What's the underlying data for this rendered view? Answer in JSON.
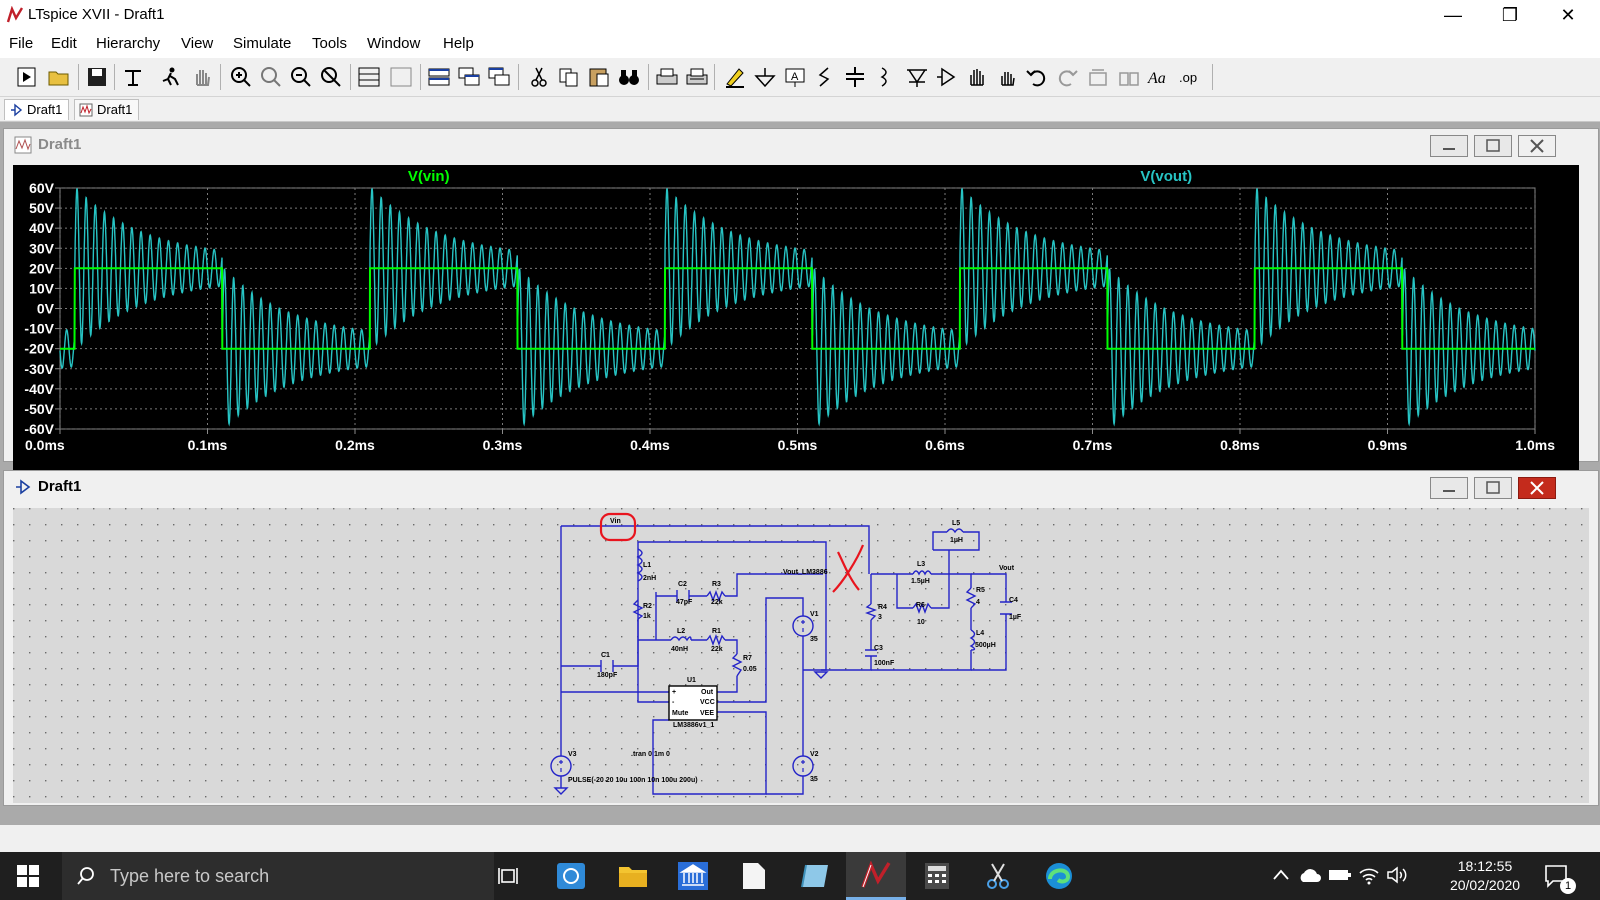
{
  "app": {
    "title": "LTspice XVII - Draft1"
  },
  "menu": [
    "File",
    "Edit",
    "Hierarchy",
    "View",
    "Simulate",
    "Tools",
    "Window",
    "Help"
  ],
  "tabs": [
    {
      "label": "Draft1",
      "icon": "schematic-icon",
      "active": true
    },
    {
      "label": "Draft1",
      "icon": "waveform-icon",
      "active": false
    }
  ],
  "waveform_window": {
    "title": "Draft1",
    "chart_data": {
      "type": "line",
      "series": [
        {
          "name": "V(vin)",
          "color": "#00ff00",
          "shape": "square",
          "amplitude": 20,
          "period_ms": 0.2
        },
        {
          "name": "V(vout)",
          "color": "#27c4c4",
          "shape": "damped-ringing",
          "offset": 20,
          "peak": 56,
          "ring_decay_to": 5
        }
      ],
      "x_ticks": [
        "0.0ms",
        "0.1ms",
        "0.2ms",
        "0.3ms",
        "0.4ms",
        "0.5ms",
        "0.6ms",
        "0.7ms",
        "0.8ms",
        "0.9ms",
        "1.0ms"
      ],
      "y_ticks": [
        "60V",
        "50V",
        "40V",
        "30V",
        "20V",
        "10V",
        "0V",
        "-10V",
        "-20V",
        "-30V",
        "-40V",
        "-50V",
        "-60V"
      ],
      "xlim": [
        0,
        1.0
      ],
      "ylim": [
        -60,
        60
      ],
      "grid": true,
      "background": "#000000"
    }
  },
  "schematic_window": {
    "title": "Draft1",
    "labels": {
      "vin": "Vin",
      "vout_lm": "Vout_LM3886",
      "vout": "Vout",
      "L1": "L1",
      "L1v": "2nH",
      "R2": "R2",
      "R2v": "1k",
      "C2": "C2",
      "C2v": "47pF",
      "R3": "R3",
      "R3v": "22k",
      "L2": "L2",
      "L2v": "40nH",
      "R1": "R1",
      "R1v": "22k",
      "R7": "R7",
      "R7v": "0.05",
      "C1": "C1",
      "C1v": "180pF",
      "U1": "U1",
      "U1name": "LM3886v1_1",
      "pin_plus": "+",
      "pin_minus": "-",
      "pin_mute": "Mute",
      "pin_out": "Out",
      "pin_vcc": "VCC",
      "pin_vee": "VEE",
      "V1": "V1",
      "V1v": "35",
      "V2": "V2",
      "V2v": "35",
      "V3": "V3",
      "V3v": "PULSE(-20 20 10u 100n 10n 100u 200u)",
      "tran": ".tran 0 1m 0",
      "R4": "R4",
      "R4v": "3",
      "C3": "C3",
      "C3v": "100nF",
      "L3": "L3",
      "L3v": "1.5µH",
      "R6": "R6",
      "R6v": "10",
      "L5": "L5",
      "L5v": "1µH",
      "R5": "R5",
      "R5v": "4",
      "L4": "L4",
      "L4v": "500µH",
      "C4": "C4",
      "C4v": "1µF"
    },
    "annotation_color": "#e8141e"
  },
  "taskbar": {
    "search_placeholder": "Type here to search",
    "time": "18:12:55",
    "date": "20/02/2020",
    "notifications": "1"
  }
}
